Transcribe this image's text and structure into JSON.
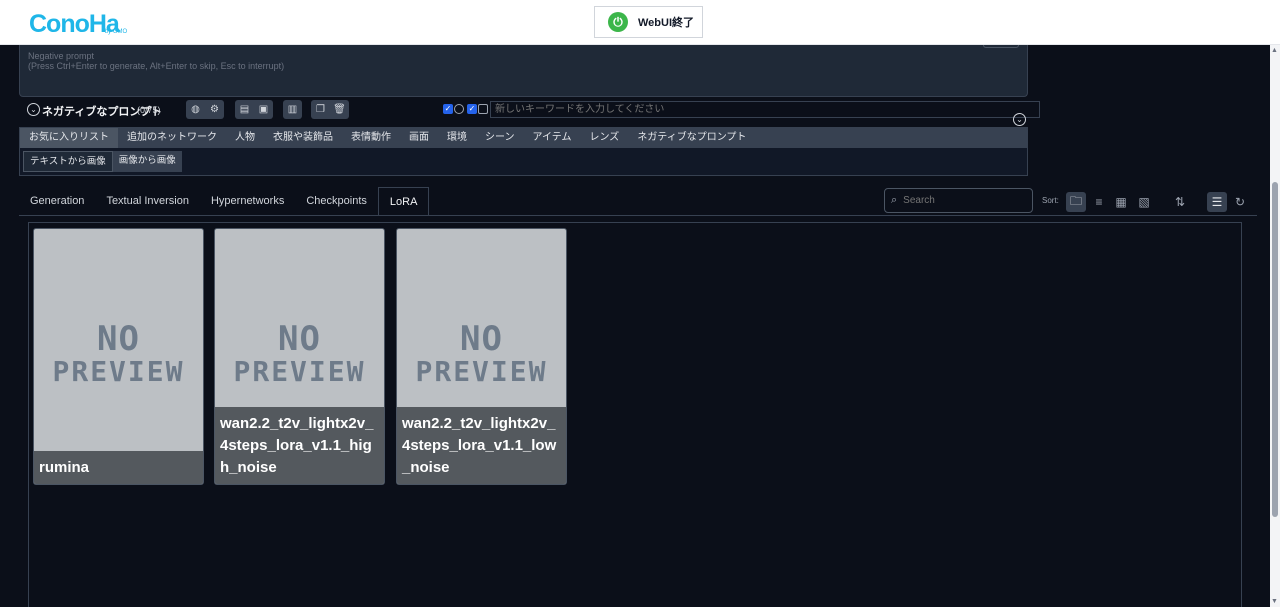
{
  "header": {
    "logo_text": "ConoHa",
    "logo_sub": "by GMO",
    "quit_label": "WebUI終了"
  },
  "negative_prompt": {
    "placeholder_line1": "Negative prompt",
    "placeholder_line2": "(Press Ctrl+Enter to generate, Alt+Enter to skip, Esc to interrupt)"
  },
  "prompt_toolbar": {
    "title": "ネガティブなプロンプト",
    "count": "(0/75)",
    "keyword_placeholder": "新しいキーワードを入力してください"
  },
  "categories": [
    "お気に入りリスト",
    "追加のネットワーク",
    "人物",
    "衣服や装飾品",
    "表情動作",
    "画面",
    "環境",
    "シーン",
    "アイテム",
    "レンズ",
    "ネガティブなプロンプト"
  ],
  "subtabs": [
    "テキストから画像",
    "画像から画像"
  ],
  "network_tabs": [
    "Generation",
    "Textual Inversion",
    "Hypernetworks",
    "Checkpoints",
    "LoRA"
  ],
  "search": {
    "placeholder": "Search"
  },
  "sort_label": "Sort:",
  "cards": [
    {
      "name": "rumina",
      "preview_line1": "NO",
      "preview_line2": "PREVIEW"
    },
    {
      "name": "wan2.2_t2v_lightx2v_4steps_lora_v1.1_high_noise",
      "preview_line1": "NO",
      "preview_line2": "PREVIEW"
    },
    {
      "name": "wan2.2_t2v_lightx2v_4steps_lora_v1.1_low_noise",
      "preview_line1": "NO",
      "preview_line2": "PREVIEW"
    }
  ],
  "colors": {
    "background": "#0b0f19",
    "panel": "#1f2937",
    "accent_blue": "#2563eb",
    "brand": "#1fb6e8",
    "power_green": "#3cb64a"
  }
}
